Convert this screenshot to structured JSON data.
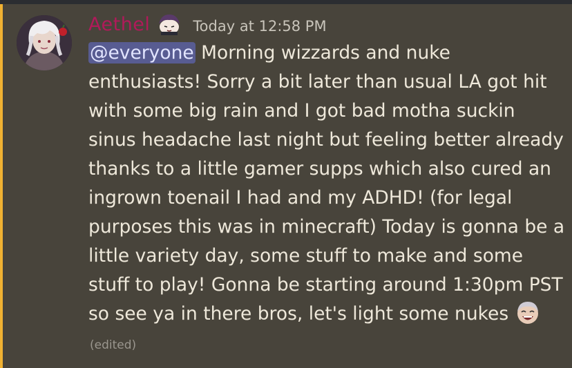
{
  "message": {
    "author": "Aethel",
    "timestamp": "Today at 12:58 PM",
    "mention": "@everyone",
    "text": " Morning wizzards and nuke enthusiasts! Sorry a bit later than usual LA got hit with some big rain and I got bad motha suckin sinus headache last night but feeling better already thanks to a little gamer supps which also cured an ingrown toenail I had and my ADHD! (for legal purposes this was in minecraft) Today is gonna be a little variety day, some stuff to make and some stuff to play! Gonna be starting around 1:30pm PST so see ya in there bros, let's light some nukes ",
    "edited_label": "(edited)",
    "role_icon": "anime-character-icon",
    "end_emoji": "laughing-face-emoji",
    "avatar": "avatar-white-haired-character"
  },
  "colors": {
    "background": "#48443b",
    "mention_bar": "#f0b132",
    "username": "#b01a5a",
    "mention_bg": "#585c92",
    "text": "#eee8da"
  }
}
